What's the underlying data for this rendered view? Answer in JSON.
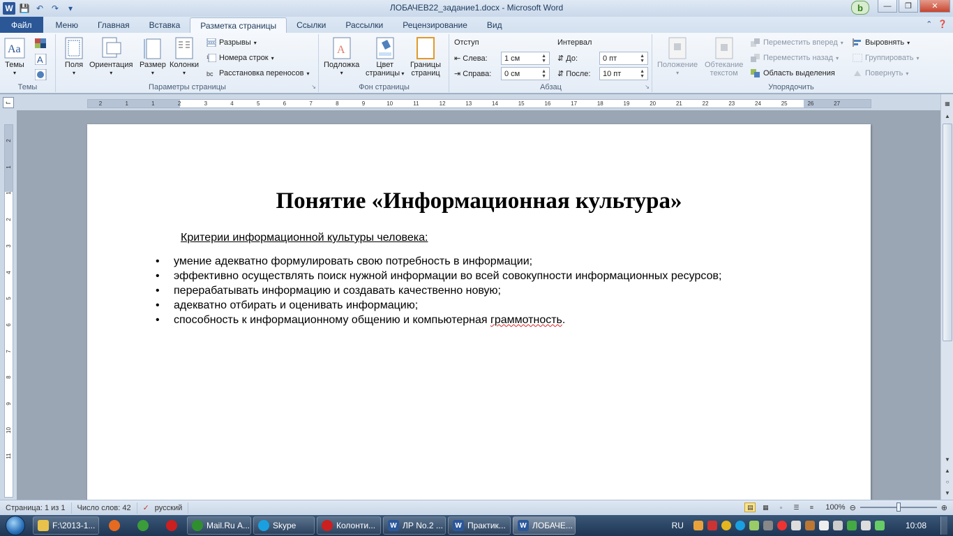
{
  "window": {
    "title": "ЛОБАЧЕВ22_задание1.docx - Microsoft Word",
    "bing_label": "b"
  },
  "tabs": [
    {
      "label": "Файл"
    },
    {
      "label": "Меню"
    },
    {
      "label": "Главная"
    },
    {
      "label": "Вставка"
    },
    {
      "label": "Разметка страницы"
    },
    {
      "label": "Ссылки"
    },
    {
      "label": "Рассылки"
    },
    {
      "label": "Рецензирование"
    },
    {
      "label": "Вид"
    }
  ],
  "ribbon": {
    "themes": {
      "button": "Темы",
      "group": "Темы"
    },
    "page_setup": {
      "group": "Параметры страницы",
      "margins": "Поля",
      "orientation": "Ориентация",
      "size": "Размер",
      "columns": "Колонки",
      "breaks": "Разрывы",
      "line_numbers": "Номера строк",
      "hyphenation": "Расстановка переносов"
    },
    "page_background": {
      "group": "Фон страницы",
      "watermark": "Подложка",
      "page_color_1": "Цвет",
      "page_color_2": "страницы",
      "page_borders_1": "Границы",
      "page_borders_2": "страниц"
    },
    "paragraph": {
      "group": "Абзац",
      "indent_title": "Отступ",
      "left_label": "Слева:",
      "left_value": "1 см",
      "right_label": "Справа:",
      "right_value": "0 см",
      "spacing_title": "Интервал",
      "before_label": "До:",
      "before_value": "0 пт",
      "after_label": "После:",
      "after_value": "10 пт"
    },
    "arrange": {
      "group": "Упорядочить",
      "position_1": "Положение",
      "wrap_1": "Обтекание",
      "wrap_2": "текстом",
      "bring_forward": "Переместить вперед",
      "send_backward": "Переместить назад",
      "selection_pane": "Область выделения",
      "align": "Выровнять",
      "group_btn": "Группировать",
      "rotate": "Повернуть"
    }
  },
  "ruler": {
    "h_ticks": [
      "2",
      "1",
      "1",
      "2",
      "3",
      "4",
      "5",
      "6",
      "7",
      "8",
      "9",
      "10",
      "11",
      "12",
      "13",
      "14",
      "15",
      "16",
      "17",
      "18",
      "19",
      "20",
      "21",
      "22",
      "23",
      "24",
      "25",
      "26",
      "27"
    ],
    "v_ticks": [
      "2",
      "1",
      "1",
      "2",
      "3",
      "4",
      "5",
      "6",
      "7",
      "8",
      "9",
      "10",
      "11"
    ]
  },
  "document": {
    "title": "Понятие «Информационная культура»",
    "subtitle": "Критерии  информационной  культуры человека:",
    "bullets": [
      "умение адекватно  формулировать  свою потребность  в информации;",
      "эффективно осуществлять поиск нужной информации  во всей совокупности  информационных  ресурсов;",
      "перерабатывать  информацию и создавать качественно  новую;",
      "адекватно  отбирать и оценивать  информацию;"
    ],
    "last_bullet_prefix": "способность  к информационному  общению и компьютерная  ",
    "last_bullet_misspelled": "граммотность",
    "last_bullet_suffix": "."
  },
  "status": {
    "page": "Страница: 1 из 1",
    "words": "Число слов: 42",
    "language": "русский",
    "zoom": "100%"
  },
  "taskbar": {
    "items": [
      {
        "label": "F:\\2013-1...",
        "color": "#e8c24a"
      },
      {
        "label": "",
        "color": "#e66a1f"
      },
      {
        "label": "",
        "color": "#3a9d3a"
      },
      {
        "label": "",
        "color": "#cc1f1f"
      },
      {
        "label": "Mail.Ru А...",
        "color": "#2f8f2f"
      },
      {
        "label": "Skype",
        "color": "#1aa0e0"
      },
      {
        "label": "Колонти...",
        "color": "#cc1f1f"
      },
      {
        "label": "ЛР No.2 ...",
        "color": "#2b579a"
      },
      {
        "label": "Практик...",
        "color": "#2b579a"
      },
      {
        "label": "ЛОБАЧЕ...",
        "color": "#2b579a"
      }
    ],
    "lang": "RU",
    "clock": "10:08"
  }
}
